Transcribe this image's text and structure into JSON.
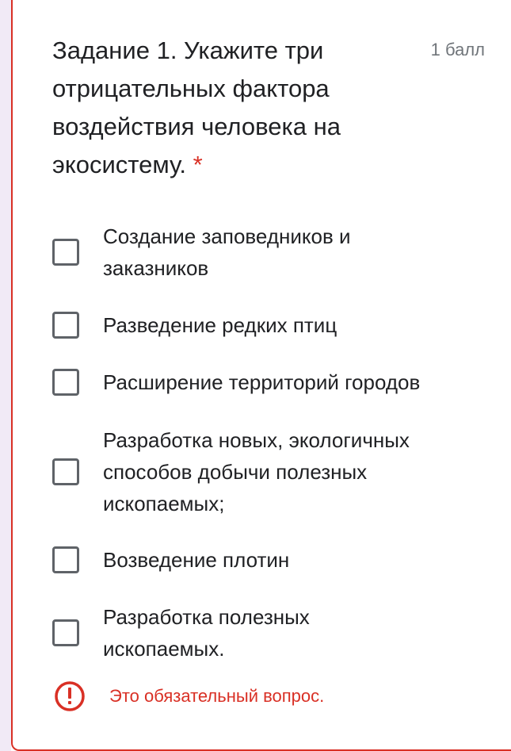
{
  "question": {
    "title": "Задание 1. Укажите три отрицательных фактора воздействия человека на экосистему.",
    "required_marker": "*",
    "points": "1 балл"
  },
  "options": [
    {
      "label": "Создание заповедников и заказников",
      "checked": false
    },
    {
      "label": "Разведение редких птиц",
      "checked": false
    },
    {
      "label": "Расширение территорий городов",
      "checked": false
    },
    {
      "label": "Разработка новых, экологичных способов добычи полезных ископаемых;",
      "checked": false
    },
    {
      "label": "Возведение плотин",
      "checked": false
    },
    {
      "label": "Разработка полезных ископаемых.",
      "checked": false
    }
  ],
  "validation": {
    "icon": "error-icon",
    "message": "Это обязательный вопрос."
  },
  "colors": {
    "error": "#d93025",
    "page_background": "#f1eaf6",
    "text": "#202124",
    "checkbox_border": "#5f6368"
  }
}
